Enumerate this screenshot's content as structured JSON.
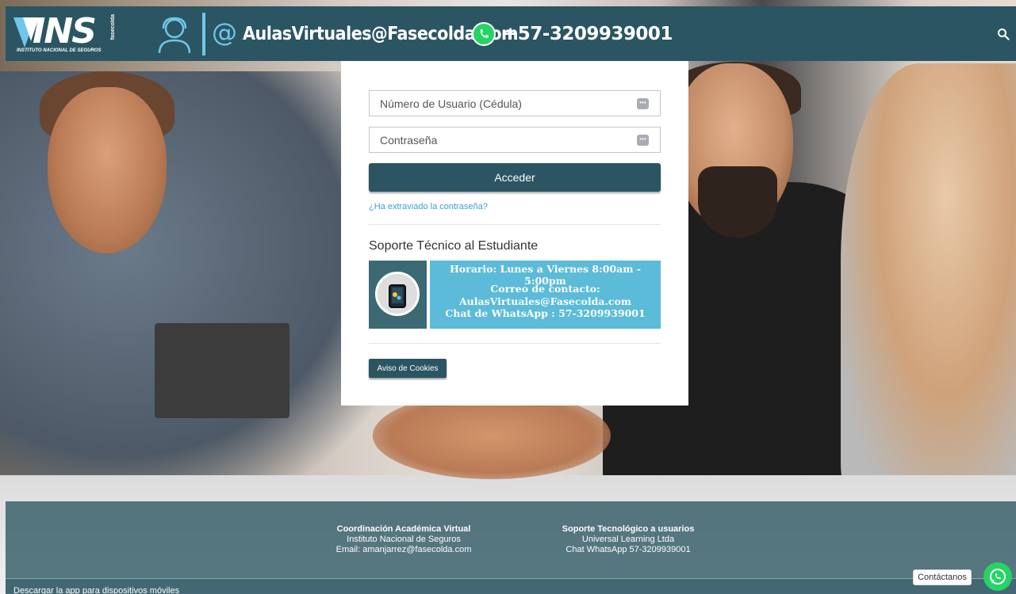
{
  "header": {
    "logo_text": "INS",
    "logo_subtitle": "INSTITUTO NACIONAL DE SEGUROS",
    "logo_vertical": "fasecolda",
    "email": "AulasVirtuales@Fasecolda.com",
    "phone": "+57-3209939001"
  },
  "login": {
    "username_placeholder": "Número de Usuario (Cédula)",
    "password_placeholder": "Contraseña",
    "submit_label": "Acceder",
    "forgot_link": "¿Ha extraviado la contraseña?"
  },
  "support": {
    "title": "Soporte Técnico al Estudiante",
    "schedule": "Horario: Lunes a Viernes 8:00am - 5:00pm",
    "contact_heading": "Correo de contacto:",
    "contact_email": "AulasVirtuales@Fasecolda.com",
    "whatsapp": "Chat de WhatsApp : 57-3209939001"
  },
  "cookies_button": "Aviso de Cookies",
  "footer": {
    "col1": {
      "title": "Coordinación Académica Virtual",
      "line1": "Instituto Nacional de Seguros",
      "line2": "Email: amanjarrez@fasecolda.com"
    },
    "col2": {
      "title": "Soporte Tecnológico a usuarios",
      "line1": "Universal Learning Ltda",
      "line2": "Chat WhatsApp 57-3209939001"
    },
    "download_link": "Descargar la app para dispositivos móviles"
  },
  "contact_widget": {
    "label": "Contáctanos"
  },
  "colors": {
    "header_bg": "#2b5562",
    "accent": "#6fc7e8",
    "banner_bg": "#5bbbd8",
    "whatsapp": "#25d366"
  }
}
